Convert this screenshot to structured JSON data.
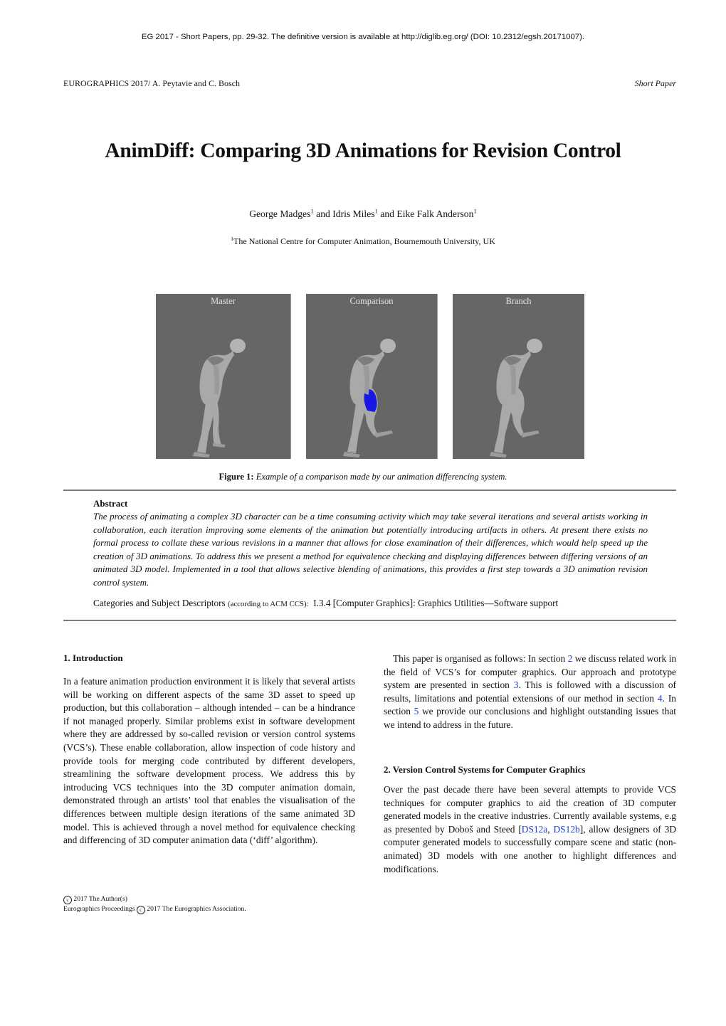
{
  "top_note": "EG 2017 - Short Papers, pp. 29-32. The definitive version is available at http://diglib.eg.org/ (DOI: 10.2312/egsh.20171007).",
  "running_head": {
    "left": "EUROGRAPHICS 2017/ A. Peytavie and C. Bosch",
    "right": "Short Paper"
  },
  "title": "AnimDiff: Comparing 3D Animations for Revision Control",
  "authors": [
    {
      "name": "George Madges",
      "affil": "1"
    },
    {
      "name": "Idris Miles",
      "affil": "1"
    },
    {
      "name": "Eike Falk Anderson",
      "affil": "1"
    }
  ],
  "author_joiner": " and ",
  "affiliation": {
    "mark": "1",
    "text": "The National Centre for Computer Animation, Bournemouth University, UK"
  },
  "figure": {
    "panels": [
      {
        "label": "Master",
        "highlight": false,
        "pose": "standing"
      },
      {
        "label": "Comparison",
        "highlight": true,
        "pose": "leg-raised"
      },
      {
        "label": "Branch",
        "highlight": false,
        "pose": "leg-raised"
      }
    ],
    "highlight_color": "#1010e8",
    "background_color": "#666666",
    "caption_label": "Figure 1:",
    "caption_text": "Example of a comparison made by our animation differencing system."
  },
  "abstract": {
    "heading": "Abstract",
    "text": "The process of animating a complex 3D character can be a time consuming activity which may take several iterations and several artists working in collaboration, each iteration improving some elements of the animation but potentially introducing artifacts in others. At present there exists no formal process to collate these various revisions in a manner that allows for close examination of their differences, which would help speed up the creation of 3D animations. To address this we present a method for equivalence checking and displaying differences between differing versions of an animated 3D model. Implemented in a tool that allows selective blending of animations, this provides a first step towards a 3D animation revision control system.",
    "ccs_label": "Categories and Subject Descriptors",
    "ccs_note": "(according to ACM CCS):",
    "ccs_value": "I.3.4 [Computer Graphics]: Graphics Utilities—Software support"
  },
  "sections": {
    "intro": {
      "heading": "1.  Introduction",
      "paragraph": "In a feature animation production environment it is likely that sev­eral artists will be working on different aspects of the same 3D asset to speed up production, but this collaboration – although intended – can be a hindrance if not managed properly. Similar problems ex­ist in software development where they are addressed by so-called revision or version control systems (VCS’s). These enable collabo­ration, allow inspection of code history and provide tools for merg­ing code contributed by different developers, streamlining the soft­ware development process. We address this by introducing VCS techniques into the 3D computer animation domain, demonstrated through an artists’ tool that enables the visualisation of the differ­ences between multiple design iterations of the same animated 3D model. This is achieved through a novel method for equivalence checking and differencing of 3D computer animation data (‘diff’ algorithm)."
    },
    "organisation": {
      "t1": "This paper is organised as follows: In section ",
      "ref1": "2",
      "t2": " we discuss re­lated work in the field of VCS’s for computer graphics. Our ap­proach and prototype system are presented in section ",
      "ref2": "3",
      "t3": ". This is followed with a discussion of results, limitations and potential ex­tensions of our method in section ",
      "ref3": "4",
      "t4": ". In section ",
      "ref4": "5",
      "t5": " we provide our conclusions and highlight outstanding issues that we intend to ad­dress in the future."
    },
    "vcs": {
      "heading": "2.  Version Control Systems for Computer Graphics",
      "t1": "Over the past decade there have been several attempts to pro­vide VCS techniques for computer graphics to aid the creation of 3D computer generated models in the creative industries. Cur­rently available systems, e.g as presented by Doboš and Steed [",
      "ref1": "DS12a",
      "sep": ", ",
      "ref2": "DS12b",
      "t2": "], allow designers of 3D computer generated mod­els to successfully compare scene and static (non-animated) 3D models with one another to highlight differences and modifications."
    }
  },
  "footer": {
    "line1": "2017 The Author(s)",
    "line2a": "Eurographics Proceedings",
    "line2b": "2017 The Eurographics Association.",
    "copyright_symbol": "c"
  },
  "colors": {
    "link": "#1a3fd6",
    "rule": "#7a7a7a"
  }
}
